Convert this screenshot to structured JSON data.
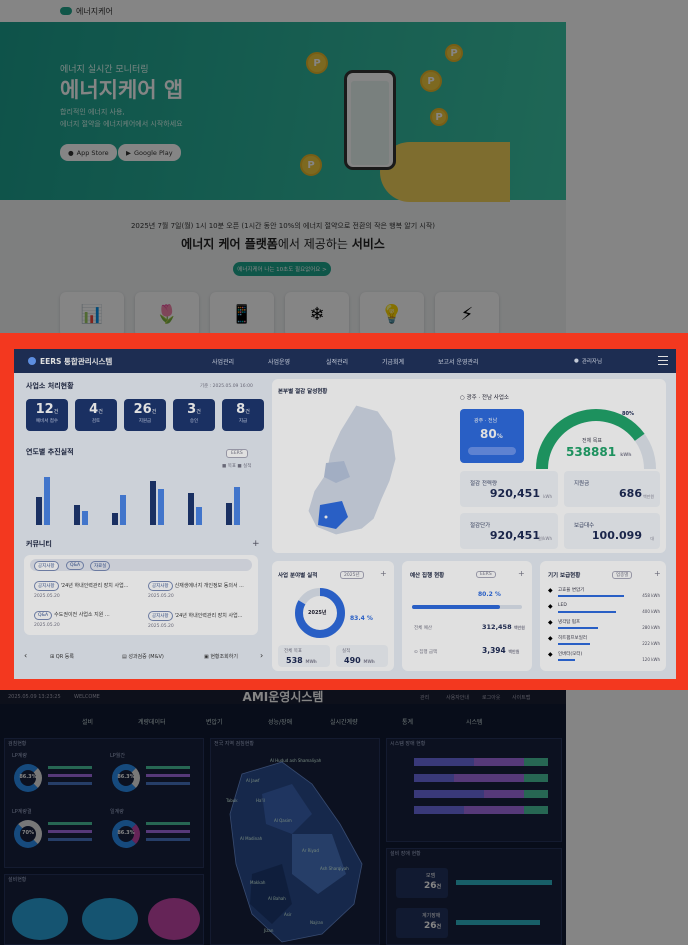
{
  "landing": {
    "brand": "에너지케어",
    "hero_subtitle": "에너지 실시간 모니터링",
    "hero_title": "에너지케어 앱",
    "hero_desc_1": "합리적인 에너지 사용,",
    "hero_desc_2": "에너지 절약을 에너지케어에서 시작하세요",
    "appstore": "App Store",
    "googleplay": "Google Play",
    "notice": "2025년 7월 7일(월) 1시 10분 오픈 (1시간 동안 10%의 에너지 절약으로 전환의 작은 행복 알기 시작)",
    "headline_1": "에너지 케어 플랫폼",
    "headline_2": "에서 제공하는 ",
    "headline_3": "서비스",
    "cta": "에너지케어 나는 10초도 필요없어요 >"
  },
  "eers": {
    "brand": "EERS 통합관리시스템",
    "menu": [
      "사업관리",
      "사업운영",
      "실적관리",
      "기금회계",
      "보고서 운영관리"
    ],
    "user": "관리자님 ",
    "status_title": "사업소 처리현황",
    "status_date": "기준 : 2025.05.09 16:00",
    "kpis": [
      {
        "value": "12",
        "unit": "건",
        "label": "예비서 접수"
      },
      {
        "value": "4",
        "unit": "건",
        "label": "검토"
      },
      {
        "value": "26",
        "unit": "건",
        "label": "지원금"
      },
      {
        "value": "3",
        "unit": "건",
        "label": "승인"
      },
      {
        "value": "8",
        "unit": "건",
        "label": "지급"
      }
    ],
    "yearly_title": "연도별 추진실적",
    "yearly_filter": "EERS",
    "yearly_legend": [
      "목표",
      "실적"
    ],
    "map_title": "본부별 절감 달성현황",
    "region_title": "광주 · 전남 사업소",
    "region_card_label": "광주 · 전남",
    "region_card_value": "80",
    "region_card_unit": "%",
    "gauge_percent": "80",
    "gauge_label": "전체 목표",
    "gauge_value": "538881",
    "gauge_unit": "kWh",
    "stats": [
      {
        "label": "절감 전력량",
        "value": "920,451",
        "unit": "kWh"
      },
      {
        "label": "지원금",
        "value": "686",
        "unit": "백만원"
      },
      {
        "label": "절감단가",
        "value": "920,451",
        "unit": "원/kWh"
      },
      {
        "label": "보급대수",
        "value": "100.099",
        "unit": "대"
      }
    ],
    "community_title": "커뮤니티",
    "community_tabs": [
      "공지사항",
      "Q&A",
      "자료실"
    ],
    "community_items": [
      {
        "tag": "공지사항",
        "text": "'24년 하내인력관리 장치 사업...",
        "date": "2025.05.20"
      },
      {
        "tag": "공지사항",
        "text": "신재생에너지 개인정보 동의서 ...",
        "date": "2025.05.20"
      },
      {
        "tag": "Q&A",
        "text": "수도권이전 사업소 지원 ...",
        "date": "2025.05.20"
      },
      {
        "tag": "공지사항",
        "text": "'24년 하내인력관리 장치 사업...",
        "date": "2025.05.20"
      }
    ],
    "quick": [
      "QR 등록",
      "성과검증 (M&V)",
      "현황조회하기"
    ],
    "perf_title": "사업 분야별 실적",
    "perf_filter": "2025년",
    "perf_center": "2025년",
    "perf_pct": "83.4",
    "perf_items": [
      {
        "label": "전체 목표",
        "value": "538",
        "unit": "MWh"
      },
      {
        "label": "실적",
        "value": "490",
        "unit": "MWh"
      }
    ],
    "budget_title": "예산 집행 현황",
    "budget_filter": "EERS",
    "budget_pct": "80.2",
    "budget_rows": [
      {
        "label": "전체 예산",
        "value": "312,458",
        "unit": "백만원"
      },
      {
        "label": "집행 금액",
        "value": "3,394",
        "unit": "백만원"
      }
    ],
    "device_title": "기기 보급현황",
    "device_filter": "업종별",
    "devices": [
      {
        "label": "고효율 변압기",
        "value": "458"
      },
      {
        "label": "LED",
        "value": "400"
      },
      {
        "label": "냉각탑 펌프",
        "value": "280"
      },
      {
        "label": "히트펌프보일러",
        "value": "222"
      },
      {
        "label": "인버터(모터)",
        "value": "120"
      }
    ],
    "device_unit": "kWh"
  },
  "ami": {
    "date": "2025.05.09  13:23:25",
    "welcome": "WELCOME",
    "title": "AMI운영시스템",
    "top_links": [
      "관리",
      "사용자안내",
      "로그아웃",
      "사이트맵"
    ],
    "menu": [
      "설비",
      "계량데이터",
      "변압기",
      "성능/장애",
      "실시간계량",
      "통계",
      "시스템"
    ],
    "panel1": "검침현황",
    "panel2": "전국 지역 검침현황",
    "panel3": "시스템 장애 현황",
    "panel4": "설비 장애 현황",
    "panel5": "설비현황",
    "donuts": [
      {
        "label": "LP계량",
        "pct": "86.3%"
      },
      {
        "label": "LP월간",
        "pct": "86.3%"
      },
      {
        "label": "LP계량결",
        "pct": "70%"
      },
      {
        "label": "일계량",
        "pct": "86.3%"
      }
    ],
    "regions": [
      "Al Hudud ash Shamaliyah",
      "Al Jawf",
      "Tabuk",
      "Ha'il",
      "Al Qasim",
      "Al Madinah",
      "Ar Riyad",
      "Ash Sharqiyah",
      "Makkah",
      "Al Bahah",
      "Asir",
      "Jizan",
      "Najran"
    ],
    "failure_cards": [
      {
        "label": "모뎀",
        "value": "26",
        "unit": "건"
      },
      {
        "label": "계기장애",
        "value": "26",
        "unit": "건"
      }
    ]
  },
  "colors": {
    "frame": "#f3381f",
    "nav": "#22345e",
    "kpi": "#1e3770",
    "accent_green": "#21a66b",
    "accent_blue": "#2f6de1",
    "landing_teal": "#1c9f8e"
  }
}
